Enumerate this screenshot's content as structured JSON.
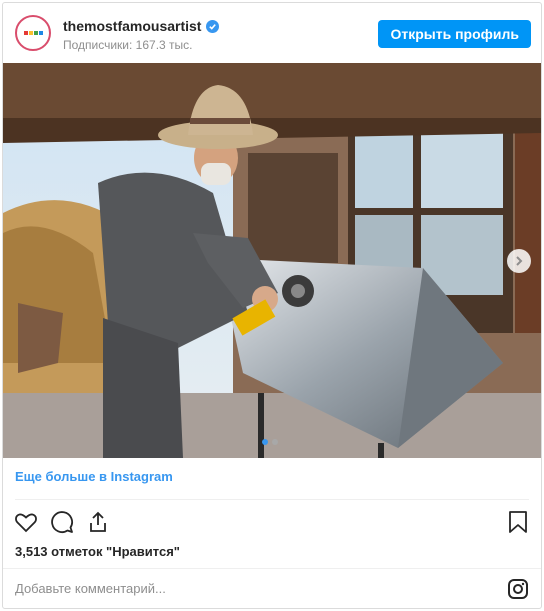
{
  "header": {
    "username": "themostfamousartist",
    "followers": "Подписчики: 167.3 тыс.",
    "open_profile": "Открыть профиль"
  },
  "media": {
    "carousel_count": 2,
    "carousel_active": 1
  },
  "more_link": "Еще больше в Instagram",
  "likes_text": "3,513 отметок \"Нравится\"",
  "comment": {
    "placeholder": "Добавьте комментарий..."
  },
  "colors": {
    "accent": "#0095f6",
    "link": "#3897f0",
    "muted": "#8e8e8e"
  },
  "icons": [
    "verified-badge-icon",
    "heart-icon",
    "comment-icon",
    "share-icon",
    "bookmark-icon",
    "instagram-logo-icon",
    "chevron-right-icon"
  ]
}
